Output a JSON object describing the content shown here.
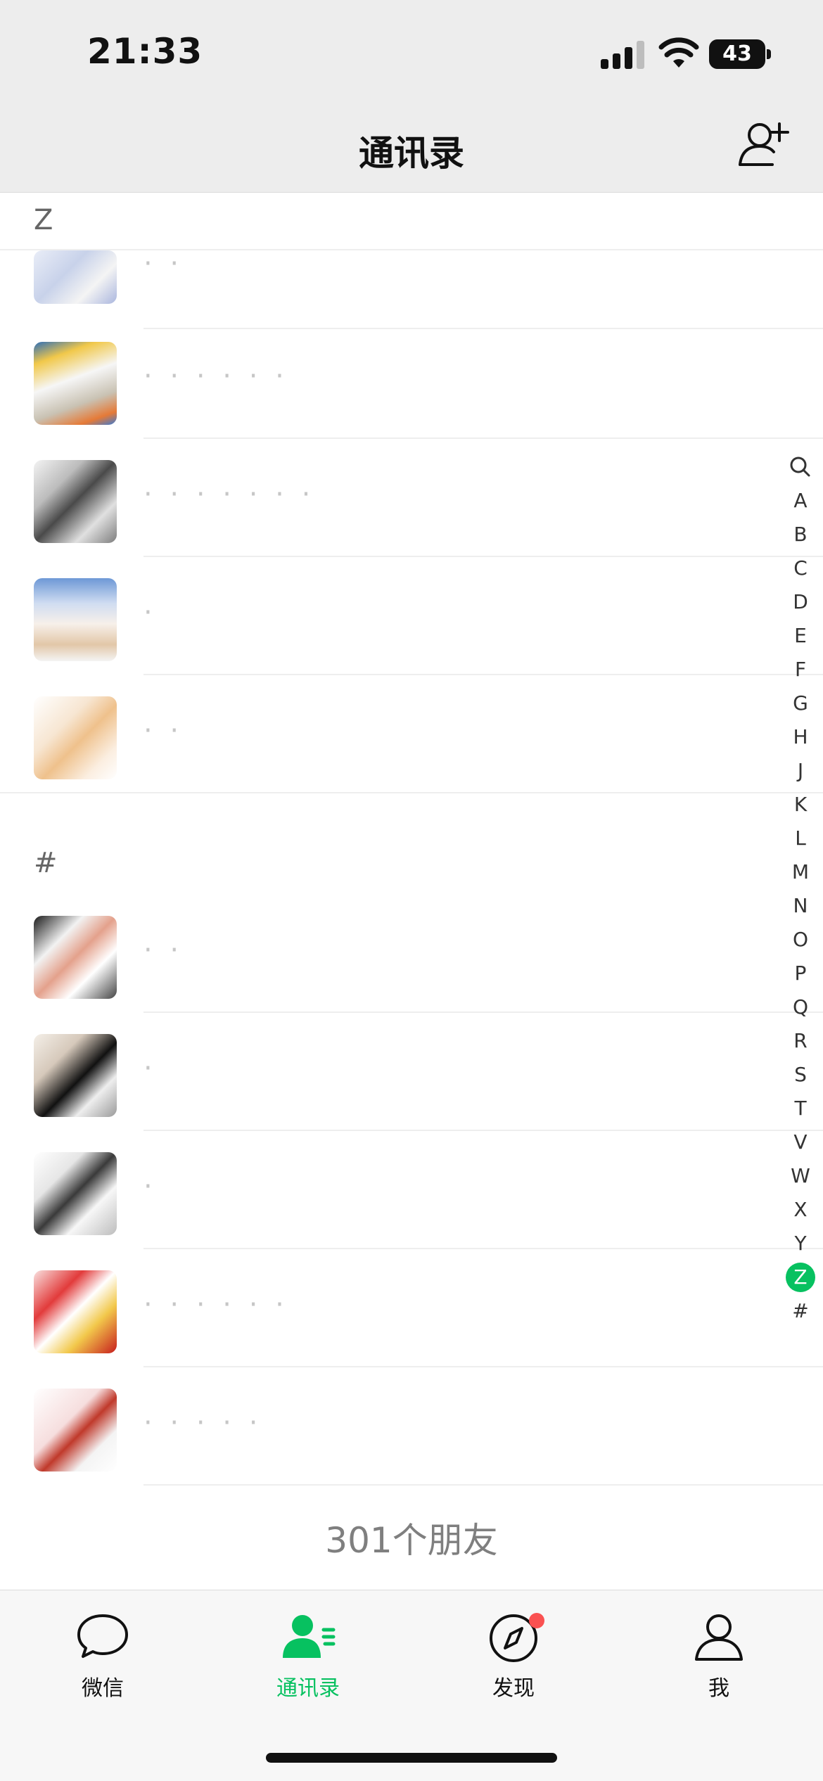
{
  "status": {
    "time": "21:33",
    "battery": "43"
  },
  "header": {
    "title": "通讯录"
  },
  "sections": [
    {
      "letter": "Z",
      "rows": [
        {
          "name": "·  ·"
        },
        {
          "name": "·   ·  ·  ·  · ·"
        },
        {
          "name": "·   ·  ·  ·  · ·  ·"
        },
        {
          "name": "·"
        },
        {
          "name": "·  ·"
        }
      ]
    },
    {
      "letter": "#",
      "rows": [
        {
          "name": "· ·"
        },
        {
          "name": "·"
        },
        {
          "name": "·"
        },
        {
          "name": "·  ·  ·  · ·  ·"
        },
        {
          "name": "·   ·  ·  ·  ·"
        }
      ]
    }
  ],
  "footer": {
    "count": "301个朋友"
  },
  "index": [
    "A",
    "B",
    "C",
    "D",
    "E",
    "F",
    "G",
    "H",
    "J",
    "K",
    "L",
    "M",
    "N",
    "O",
    "P",
    "Q",
    "R",
    "S",
    "T",
    "V",
    "W",
    "X",
    "Y",
    "Z",
    "#"
  ],
  "index_active": "Z",
  "tabs": [
    {
      "label": "微信",
      "icon": "chat-bubble-icon"
    },
    {
      "label": "通讯录",
      "icon": "contacts-icon"
    },
    {
      "label": "发现",
      "icon": "compass-icon"
    },
    {
      "label": "我",
      "icon": "person-icon"
    }
  ],
  "colors": {
    "accent": "#07c160",
    "badge": "#fa5151"
  }
}
